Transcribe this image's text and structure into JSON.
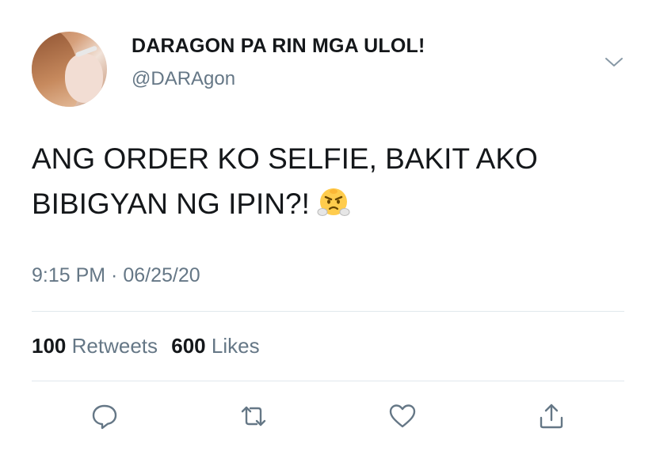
{
  "author": {
    "display_name": "DARAGON PA RIN MGA ULOL!",
    "handle": "@DARAgon"
  },
  "tweet": {
    "text_line1": "ANG ORDER KO SELFIE, BAKIT AKO",
    "text_line2": "BIBIGYAN NG IPIN?!",
    "emoji": "face-with-steam-from-nose",
    "timestamp": "9:15 PM · 06/25/20"
  },
  "stats": {
    "retweets_count": "100",
    "retweets_label": "Retweets",
    "likes_count": "600",
    "likes_label": "Likes"
  },
  "colors": {
    "text": "#14171a",
    "secondary": "#657786",
    "divider": "#e1e8ed"
  },
  "icons": [
    "chevron-down-icon",
    "reply-icon",
    "retweet-icon",
    "like-icon",
    "share-icon"
  ]
}
